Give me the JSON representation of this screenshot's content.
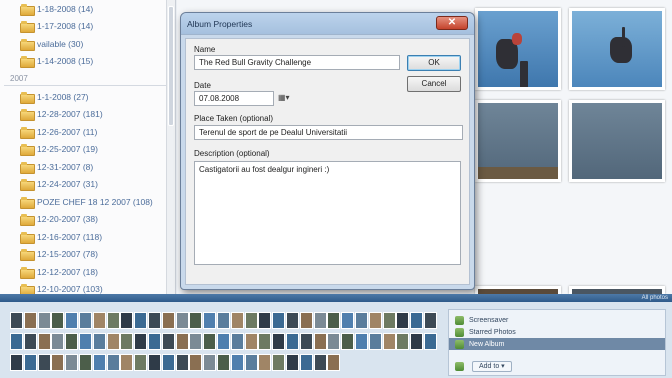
{
  "folders_top": [
    "1-18-2008 (14)",
    "1-17-2008 (14)",
    "vailable (30)",
    "1-14-2008 (15)"
  ],
  "group_label": "2007",
  "folders_bottom": [
    "1-1-2008 (27)",
    "12-28-2007 (181)",
    "12-26-2007 (11)",
    "12-25-2007 (19)",
    "12-31-2007 (8)",
    "12-24-2007 (31)",
    "POZE CHEF 18 12 2007 (108)",
    "12-20-2007 (38)",
    "12-16-2007 (118)",
    "12-15-2007 (78)",
    "12-12-2007 (18)",
    "12-10-2007 (103)"
  ],
  "dialog": {
    "title": "Album Properties",
    "close_glyph": "✕",
    "name_label": "Name",
    "name_value": "The Red Bull Gravity Challenge",
    "date_label": "Date",
    "date_value": "07.08.2008",
    "place_label": "Place Taken (optional)",
    "place_value": "Terenul de sport de pe Dealul Universitatii",
    "desc_label": "Description (optional)",
    "desc_value": "Castigatorii au fost dealgur ingineri :)",
    "ok_label": "OK",
    "cancel_label": "Cancel",
    "calendar_glyph": "▦▾"
  },
  "status_strip": {
    "right_label": "All photos"
  },
  "tags_panel": {
    "items": [
      "Screensaver",
      "Starred Photos",
      "New Album"
    ],
    "selected_index": 2,
    "add_to_label": "Add to:",
    "add_to_button": "Add to ▾"
  },
  "colors": {
    "accent": "#2e5a8a",
    "folder_text": "#4b6c9a",
    "dialog_frame": "#c9d9eb"
  }
}
